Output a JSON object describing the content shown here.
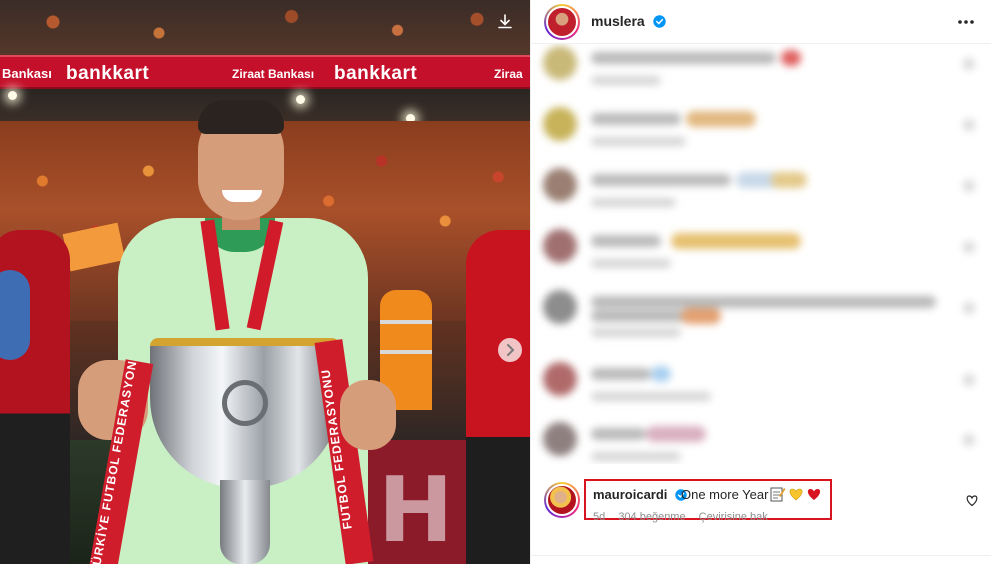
{
  "post": {
    "author": "muslera",
    "author_verified": true,
    "photo": {
      "banner_texts": [
        "Bankası",
        "bankkart",
        "Ziraat Bankası",
        "bankkart",
        "Ziraa"
      ],
      "ribbon_left": "TÜRKİYE FUTBOL FEDERASYONU",
      "ribbon_right": "FUTBOL FEDERASYONU",
      "led_text": "H"
    }
  },
  "comments": {
    "highlighted": {
      "username": "mauroicardi",
      "verified": true,
      "text": "One more Year",
      "emojis": [
        "memo",
        "yellow-heart",
        "red-heart"
      ],
      "time": "5d",
      "likes": "304 beğenme",
      "translate": "Çevirisine bak"
    }
  },
  "icons": {
    "save": "download-icon",
    "next": "chevron-right-icon",
    "more": "more-horizontal-icon",
    "verified": "verified-badge-icon",
    "like": "heart-outline-icon"
  },
  "colors": {
    "highlight_box": "#d7141f",
    "verified_blue": "#0095f6",
    "text_primary": "#262626",
    "text_secondary": "#8e8e8e"
  }
}
